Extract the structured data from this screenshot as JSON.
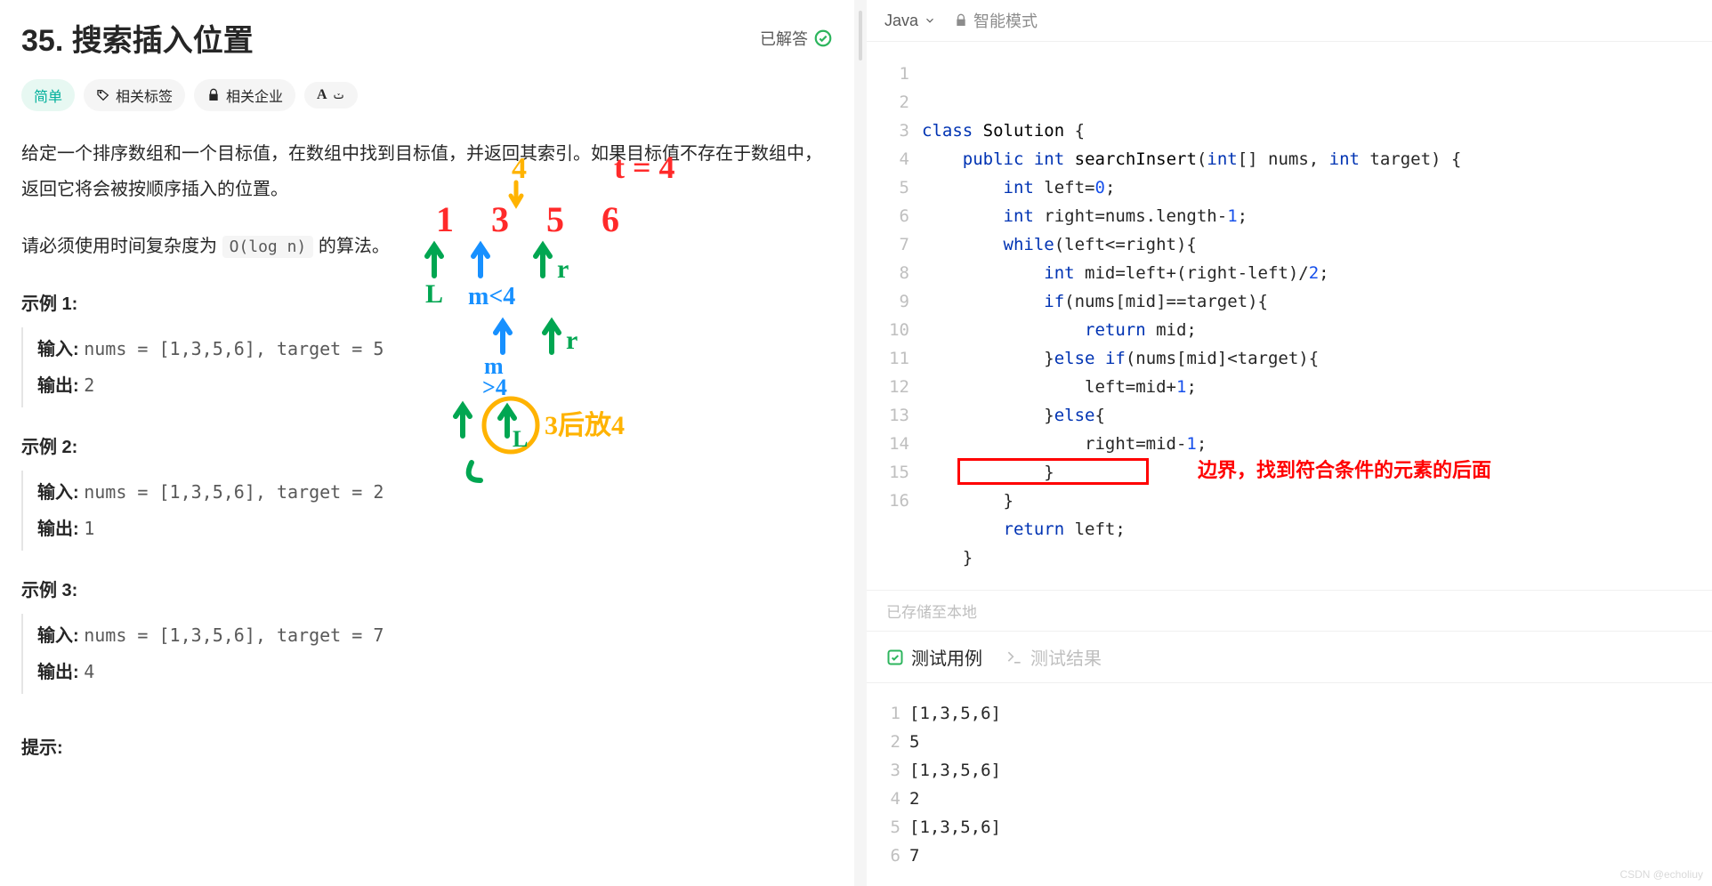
{
  "problem": {
    "title": "35. 搜索插入位置",
    "solved_label": "已解答",
    "difficulty": "简单",
    "tags_label": "相关标签",
    "companies_label": "相关企业",
    "font_icon_label": "Aٯ",
    "desc_line1": "给定一个排序数组和一个目标值，在数组中找到目标值，并返回其索引。如果目标值不存在于数组中，返回它将会被按顺序插入的位置。",
    "desc_line2_pre": "请必须使用时间复杂度为 ",
    "desc_line2_code": "O(log n)",
    "desc_line2_post": " 的算法。",
    "example1_title": "示例 1:",
    "example2_title": "示例 2:",
    "example3_title": "示例 3:",
    "input_label": "输入: ",
    "output_label": "输出: ",
    "ex1_input": "nums = [1,3,5,6], target = 5",
    "ex1_output": "2",
    "ex2_input": "nums = [1,3,5,6], target = 2",
    "ex2_output": "1",
    "ex3_input": "nums = [1,3,5,6], target = 7",
    "ex3_output": "4",
    "hints_title": "提示:"
  },
  "editor": {
    "language": "Java",
    "mode_label": "智能模式",
    "red_note": "边界，找到符合条件的元素的后面",
    "save_status": "已存储至本地",
    "code_lines": [
      [
        [
          "kw",
          "class"
        ],
        [
          "",
          ""
        ],
        [
          "cls",
          "Solution"
        ],
        [
          "",
          ""
        ],
        [
          "",
          "{"
        ]
      ],
      [
        [
          "",
          "    "
        ],
        [
          "kw",
          "public"
        ],
        [
          "",
          ""
        ],
        [
          "type",
          "int"
        ],
        [
          "",
          ""
        ],
        [
          "fn",
          "searchInsert"
        ],
        [
          "",
          "("
        ],
        [
          "type",
          "int"
        ],
        [
          "",
          "[] nums, "
        ],
        [
          "type",
          "int"
        ],
        [
          "",
          " target) {"
        ]
      ],
      [
        [
          "",
          "        "
        ],
        [
          "type",
          "int"
        ],
        [
          "",
          " left="
        ],
        [
          "num",
          "0"
        ],
        [
          "",
          ";"
        ]
      ],
      [
        [
          "",
          "        "
        ],
        [
          "type",
          "int"
        ],
        [
          "",
          " right=nums.length-"
        ],
        [
          "num",
          "1"
        ],
        [
          "",
          ";"
        ]
      ],
      [
        [
          "",
          "        "
        ],
        [
          "kw",
          "while"
        ],
        [
          "",
          "(left<=right){"
        ]
      ],
      [
        [
          "",
          "            "
        ],
        [
          "type",
          "int"
        ],
        [
          "",
          " mid=left+(right-left)/"
        ],
        [
          "num",
          "2"
        ],
        [
          "",
          ";"
        ]
      ],
      [
        [
          "",
          "            "
        ],
        [
          "kw",
          "if"
        ],
        [
          "",
          "(nums[mid]==target){"
        ]
      ],
      [
        [
          "",
          "                "
        ],
        [
          "kw",
          "return"
        ],
        [
          "",
          " mid;"
        ]
      ],
      [
        [
          "",
          "            }"
        ],
        [
          "kw",
          "else"
        ],
        [
          "",
          ""
        ],
        [
          "kw",
          "if"
        ],
        [
          "",
          "(nums[mid]<target){"
        ]
      ],
      [
        [
          "",
          "                left=mid+"
        ],
        [
          "num",
          "1"
        ],
        [
          "",
          ";"
        ]
      ],
      [
        [
          "",
          "            }"
        ],
        [
          "kw",
          "else"
        ],
        [
          "",
          "{"
        ]
      ],
      [
        [
          "",
          "                right=mid-"
        ],
        [
          "num",
          "1"
        ],
        [
          "",
          ";"
        ]
      ],
      [
        [
          "",
          "            }"
        ]
      ],
      [
        [
          "",
          "        }"
        ]
      ],
      [
        [
          "",
          "        "
        ],
        [
          "kw",
          "return"
        ],
        [
          "",
          " left;"
        ]
      ],
      [
        [
          "",
          "    }"
        ]
      ]
    ]
  },
  "tabs": {
    "testcase": "测试用例",
    "result": "测试结果"
  },
  "testcases": [
    "[1,3,5,6]",
    "5",
    "[1,3,5,6]",
    "2",
    "[1,3,5,6]",
    "7"
  ],
  "watermark": "CSDN @echoliuy",
  "annotations": {
    "t_eq_4": "t = 4",
    "four": "4",
    "array": "1 3 5 6",
    "l": "L",
    "m_lt_4": "m<4",
    "r": "r",
    "m_gt_4": "m\\n>4",
    "three_after_4": "3后放4"
  }
}
